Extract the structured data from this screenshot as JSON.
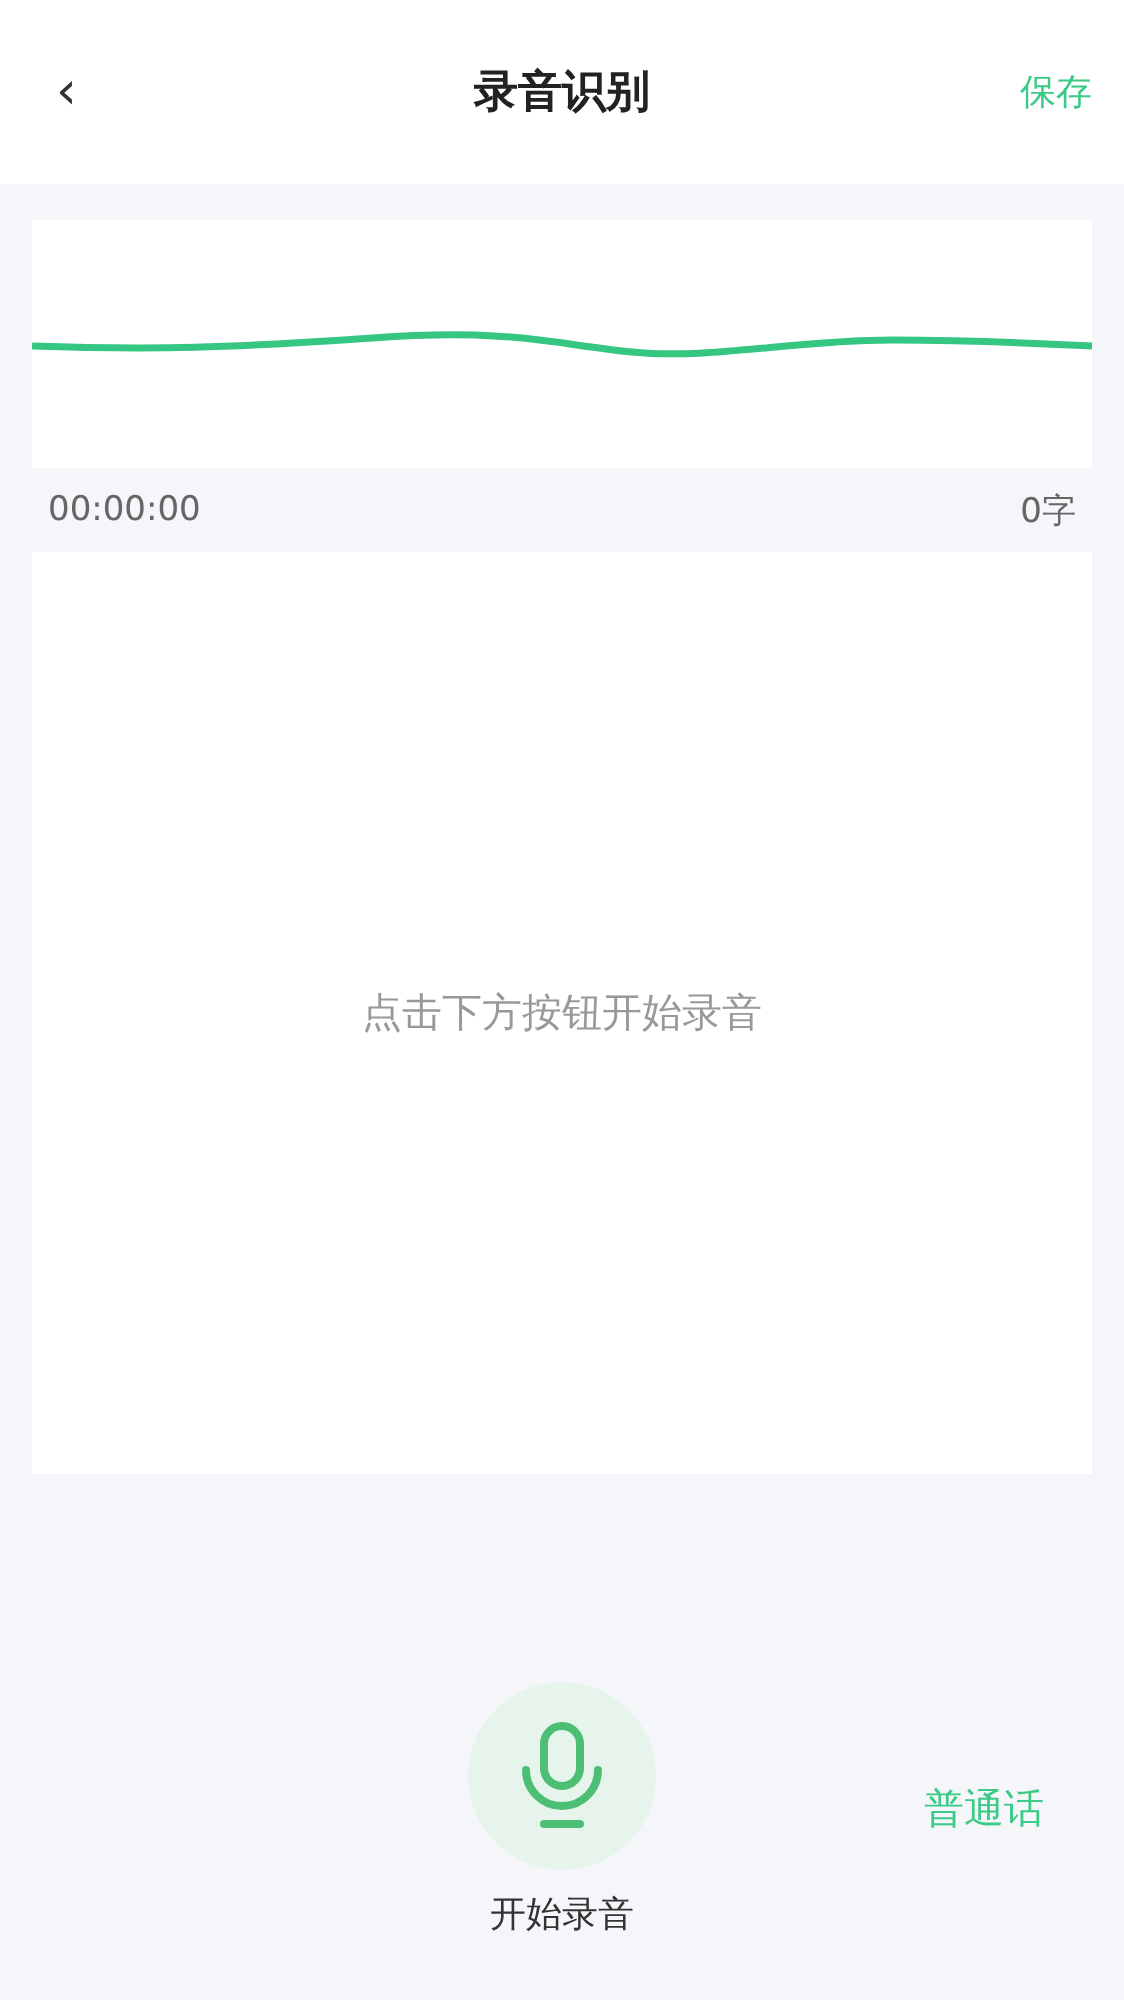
{
  "header": {
    "back": "‹",
    "title": "录音识别",
    "action": "保存"
  },
  "recording": {
    "elapsed": "00:00:00",
    "char_count": "0字"
  },
  "transcript": {
    "placeholder": "点击下方按钮开始录音"
  },
  "controls": {
    "record_label": "开始录音",
    "language": "普通话"
  }
}
